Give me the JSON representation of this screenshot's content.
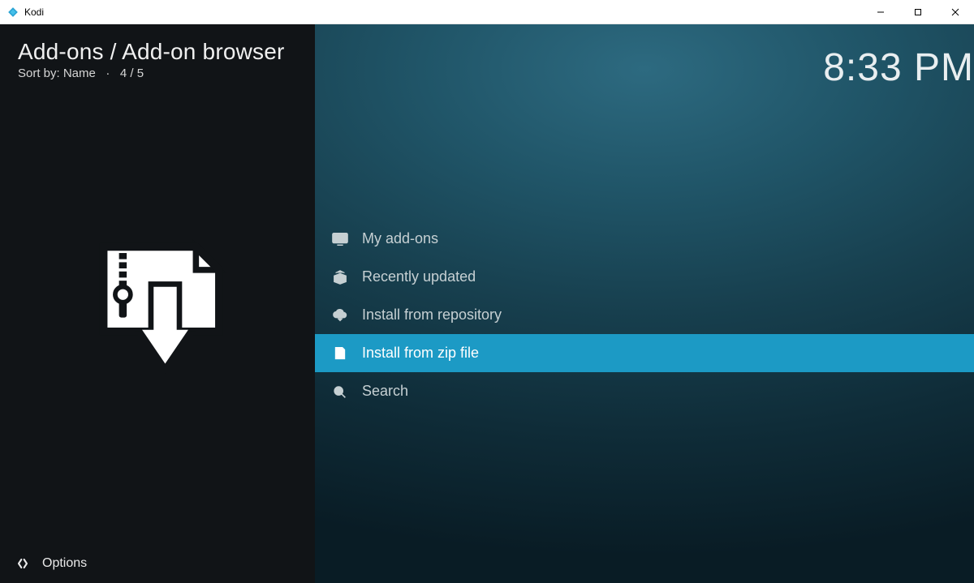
{
  "window": {
    "app_title": "Kodi"
  },
  "header": {
    "breadcrumb": "Add-ons / Add-on browser",
    "sort_label": "Sort by: Name",
    "separator": "·",
    "position": "4 / 5",
    "clock": "8:33 PM"
  },
  "sidebar": {
    "options_label": "Options"
  },
  "menu": {
    "items": [
      {
        "id": "my-addons",
        "label": "My add-ons",
        "selected": false
      },
      {
        "id": "recently-updated",
        "label": "Recently updated",
        "selected": false
      },
      {
        "id": "install-from-repository",
        "label": "Install from repository",
        "selected": false
      },
      {
        "id": "install-from-zip-file",
        "label": "Install from zip file",
        "selected": true
      },
      {
        "id": "search",
        "label": "Search",
        "selected": false
      }
    ]
  }
}
